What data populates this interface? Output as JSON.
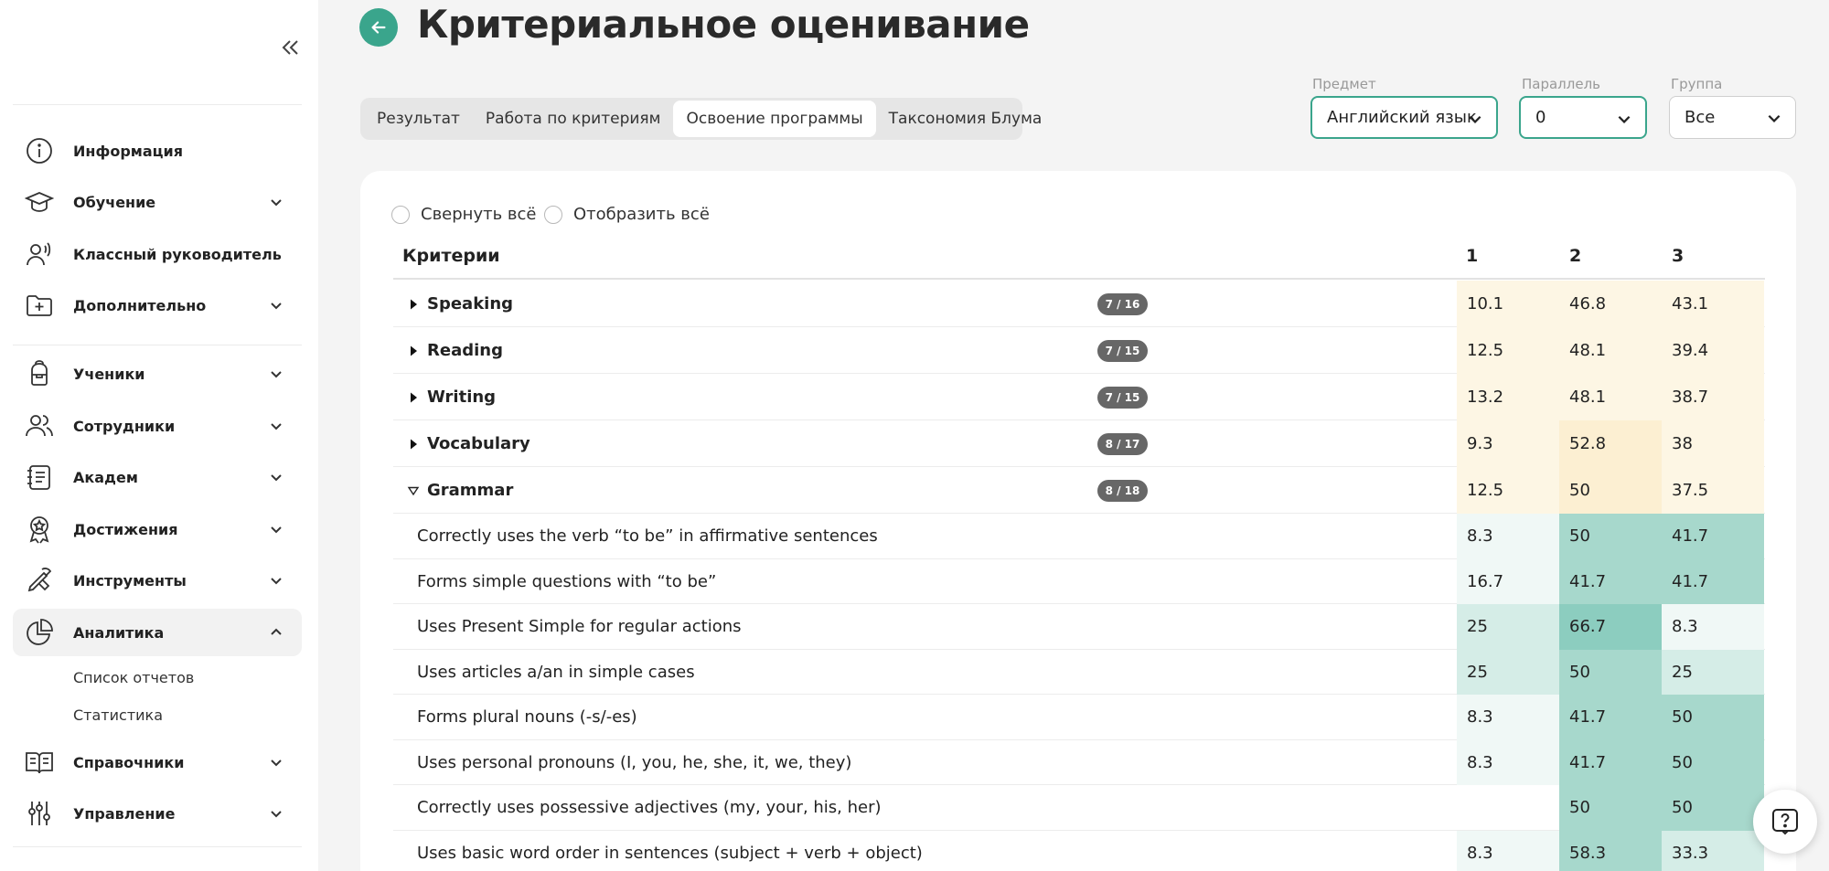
{
  "header": {
    "title": "Критериальное оценивание"
  },
  "tabs": [
    {
      "label": "Результат",
      "active": false
    },
    {
      "label": "Работа по критериям",
      "active": false
    },
    {
      "label": "Освоение программы",
      "active": true
    },
    {
      "label": "Таксономия Блума",
      "active": false
    }
  ],
  "filters": {
    "subject": {
      "label": "Предмет",
      "value": "Английский язык"
    },
    "parallel": {
      "label": "Параллель",
      "value": "0"
    },
    "group": {
      "label": "Группа",
      "value": "Все"
    }
  },
  "controls": {
    "collapse_all": "Свернуть всё",
    "expand_all": "Отобразить всё"
  },
  "table": {
    "headers": {
      "criteria": "Критерии",
      "c1": "1",
      "c2": "2",
      "c3": "3"
    },
    "groups": [
      {
        "name": "Speaking",
        "badge": "7 / 16",
        "v1": "10.1",
        "v2": "46.8",
        "v3": "43.1"
      },
      {
        "name": "Reading",
        "badge": "7 / 15",
        "v1": "12.5",
        "v2": "48.1",
        "v3": "39.4"
      },
      {
        "name": "Writing",
        "badge": "7 / 15",
        "v1": "13.2",
        "v2": "48.1",
        "v3": "38.7"
      },
      {
        "name": "Vocabulary",
        "badge": "8 / 17",
        "v1": "9.3",
        "v2": "52.8",
        "v3": "38"
      },
      {
        "name": "Grammar",
        "badge": "8 / 18",
        "v1": "12.5",
        "v2": "50",
        "v3": "37.5",
        "expanded": true
      }
    ],
    "subrows": [
      {
        "name": "Correctly uses the verb “to be” in affirmative sentences",
        "v1": "8.3",
        "v2": "50",
        "v3": "41.7"
      },
      {
        "name": "Forms simple questions with “to be”",
        "v1": "16.7",
        "v2": "41.7",
        "v3": "41.7"
      },
      {
        "name": "Uses Present Simple for regular actions",
        "v1": "25",
        "v2": "66.7",
        "v3": "8.3"
      },
      {
        "name": "Uses articles a/an in simple cases",
        "v1": "25",
        "v2": "50",
        "v3": "25"
      },
      {
        "name": "Forms plural nouns (-s/-es)",
        "v1": "8.3",
        "v2": "41.7",
        "v3": "50"
      },
      {
        "name": "Uses personal pronouns (I, you, he, she, it, we, they)",
        "v1": "8.3",
        "v2": "41.7",
        "v3": "50"
      },
      {
        "name": "Correctly uses possessive adjectives (my, your, his, her)",
        "v1": "",
        "v2": "50",
        "v3": "50"
      },
      {
        "name": "Uses basic word order in sentences (subject + verb + object)",
        "v1": "8.3",
        "v2": "58.3",
        "v3": "33.3"
      }
    ]
  },
  "sidebar": {
    "items": [
      {
        "label": "Информация",
        "icon": "info-icon",
        "chevron": "none"
      },
      {
        "label": "Обучение",
        "icon": "graduation-cap-icon",
        "chevron": "down"
      },
      {
        "label": "Классный руководитель",
        "icon": "person-voice-icon",
        "chevron": "none"
      },
      {
        "label": "Дополнительно",
        "icon": "folder-plus-icon",
        "chevron": "down"
      },
      {
        "label": "Ученики",
        "icon": "backpack-icon",
        "chevron": "down"
      },
      {
        "label": "Сотрудники",
        "icon": "users-icon",
        "chevron": "down"
      },
      {
        "label": "Академ",
        "icon": "notebook-icon",
        "chevron": "down"
      },
      {
        "label": "Достижения",
        "icon": "medal-icon",
        "chevron": "down"
      },
      {
        "label": "Инструменты",
        "icon": "tools-icon",
        "chevron": "down"
      },
      {
        "label": "Аналитика",
        "icon": "pie-chart-icon",
        "chevron": "up"
      },
      {
        "label": "Справочники",
        "icon": "book-icon",
        "chevron": "down"
      },
      {
        "label": "Управление",
        "icon": "sliders-icon",
        "chevron": "down"
      }
    ],
    "subitems": [
      "Список отчетов",
      "Статистика"
    ]
  },
  "colors": {
    "accent": "#3aa58c",
    "yellow_light": "#fdf6e4",
    "yellow_mid": "#fcefd2",
    "green_scale": [
      "#f0f8f6",
      "#d5ede7",
      "#a7d8cc",
      "#8ccdbf"
    ]
  }
}
